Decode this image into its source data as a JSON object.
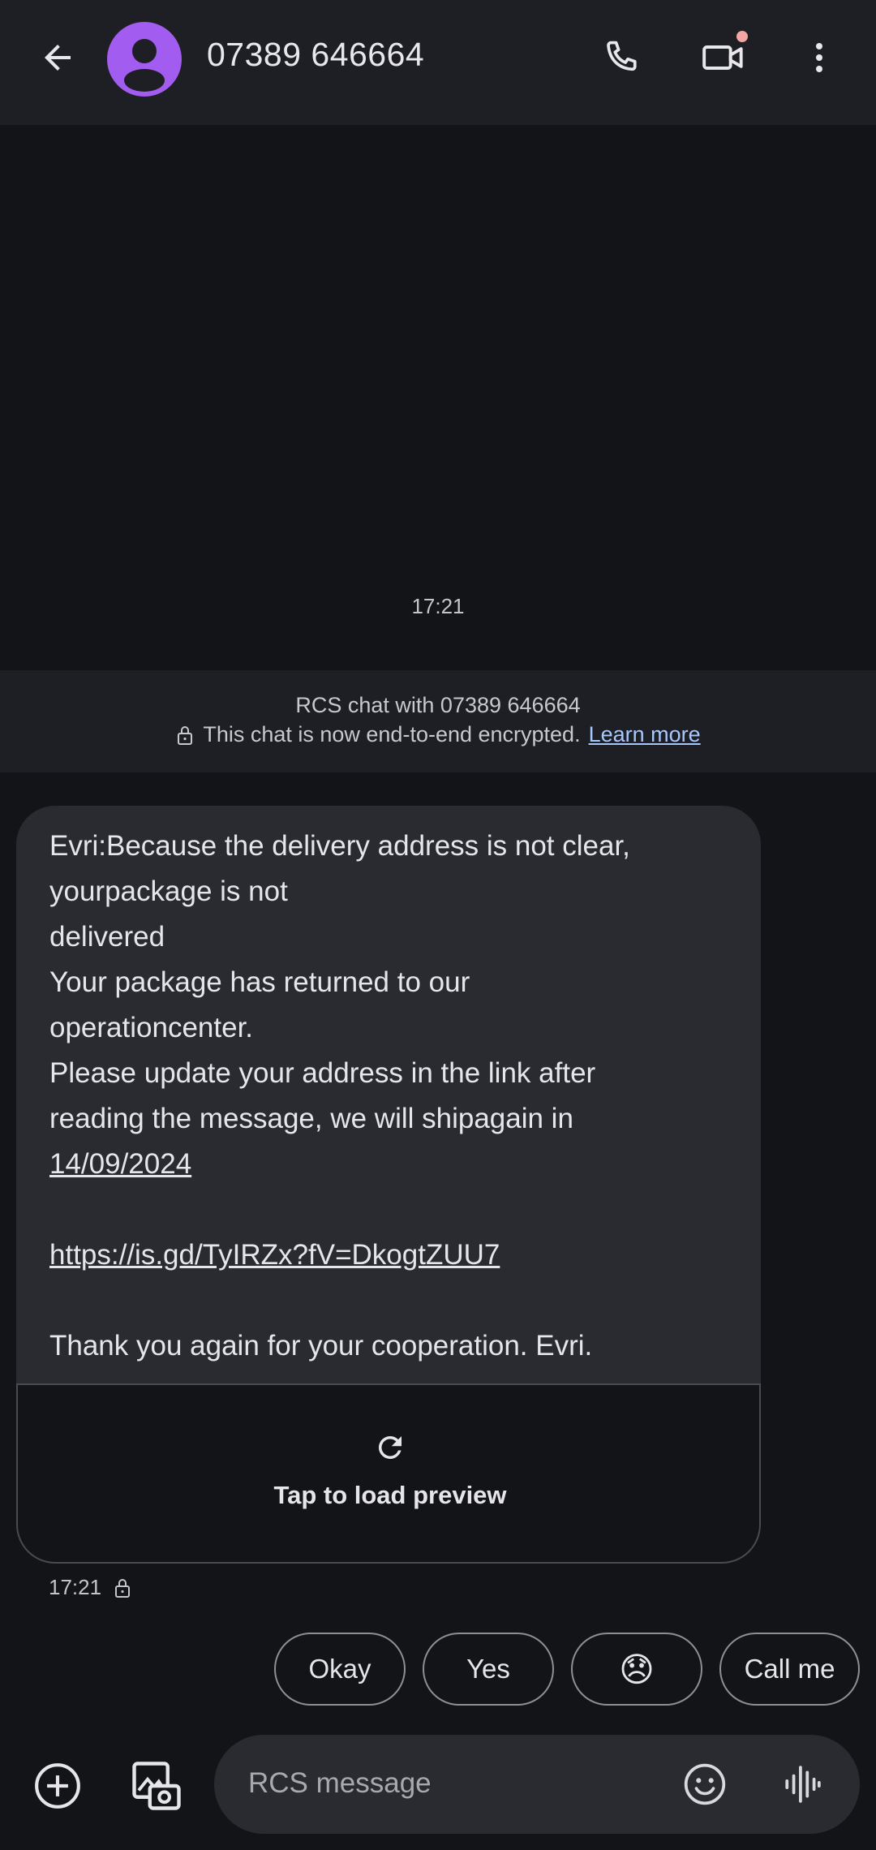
{
  "header": {
    "contact": "07389 646664",
    "icons": [
      "back-arrow-icon",
      "avatar-person-icon",
      "phone-icon",
      "video-call-icon",
      "more-vert-icon"
    ]
  },
  "thread": {
    "time_divider": "17:21",
    "banner_line1": "RCS chat with 07389 646664",
    "banner_line2": "This chat is now end-to-end encrypted.",
    "learn_more": "Learn more"
  },
  "message": {
    "body_part1": "Evri:Because the delivery address is not clear,\nyourpackage is not\ndelivered\nYour package has returned to our\noperationcenter.\nPlease update your address in the link after\nreading the message, we will shipagain in\n",
    "date_link": "14/09/2024",
    "url": "https://is.gd/TyIRZx?fV=DkogtZUU7",
    "closing": "Thank you again for your cooperation. Evri.",
    "preview_label": "Tap to load preview",
    "time": "17:21"
  },
  "smart_replies": [
    "Okay",
    "Yes",
    "😞",
    "Call me"
  ],
  "compose": {
    "placeholder": "RCS message"
  },
  "colors": {
    "background": "#131418",
    "surface": "#1e1f24",
    "bubble": "#2a2b31",
    "avatar": "#a25cf0",
    "link": "#a8c7fa",
    "notification_dot": "#f2a7a4"
  }
}
